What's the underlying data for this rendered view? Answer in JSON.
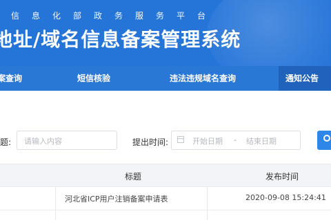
{
  "header": {
    "subtitle": "信息化部政务服务平台",
    "title": "地址/域名信息备案管理系统"
  },
  "nav": {
    "items": [
      {
        "label": "案查询"
      },
      {
        "label": "短信核验"
      },
      {
        "label": "违法违规域名查询"
      },
      {
        "label": "通知公告"
      }
    ]
  },
  "search": {
    "title_label": "题:",
    "title_placeholder": "请输入内容",
    "time_label": "提出时间:",
    "start_placeholder": "开始日期",
    "range_separator": "-",
    "end_placeholder": "结束日期"
  },
  "table": {
    "headers": [
      "标题",
      "发布时间"
    ],
    "rows": [
      {
        "title": "河北省ICP用户注销备案申请表",
        "date": "2020-09-08 15:24:41"
      }
    ]
  },
  "colors": {
    "banner": "#2574d8",
    "nav": "#2a78d6",
    "nav_active": "#1f63bd",
    "search_button": "#2e86e8",
    "table_header_bg": "#f2f4f7"
  }
}
